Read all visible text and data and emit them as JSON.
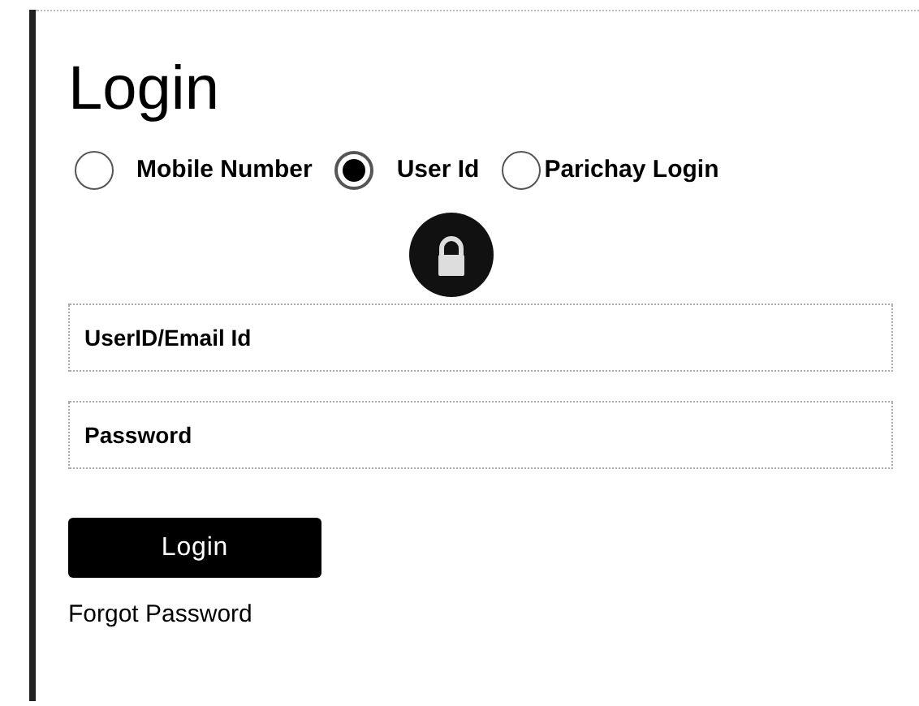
{
  "title": "Login",
  "login_options": [
    {
      "label": "Mobile Number",
      "selected": false
    },
    {
      "label": "User Id",
      "selected": true
    },
    {
      "label": "Parichay Login",
      "selected": false
    }
  ],
  "fields": [
    {
      "placeholder": "UserID/Email Id"
    },
    {
      "placeholder": "Password"
    }
  ],
  "login_button": "Login",
  "forgot_link": "Forgot Password"
}
